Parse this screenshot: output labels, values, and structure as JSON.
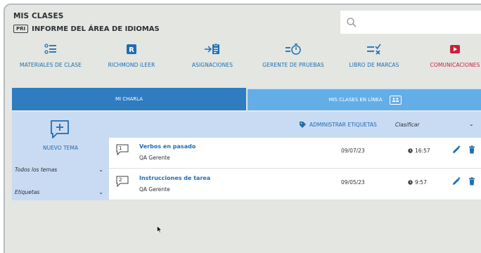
{
  "header": {
    "title": "MIS CLASES",
    "level_badge": "PRI",
    "subtitle": "INFORME DEL ÁREA DE IDIOMAS",
    "search_placeholder": ""
  },
  "nav": [
    {
      "label": "MATERIALES DE CLASE",
      "icon": "list-icon"
    },
    {
      "label": "RICHMOND iLEER",
      "icon": "richmond-r-icon"
    },
    {
      "label": "ASIGNACIONES",
      "icon": "assignment-icon"
    },
    {
      "label": "GERENTE DE PRUEBAS",
      "icon": "timer-icon"
    },
    {
      "label": "LIBRO DE MARCAS",
      "icon": "gradebook-icon"
    },
    {
      "label": "COMUNICACIONES",
      "icon": "play-icon"
    }
  ],
  "tabs": {
    "active": "MI CHARLA",
    "inactive": "MIS CLASES EN LÍNEA"
  },
  "sidebar": {
    "new_topic": "NUEVO TEMA",
    "filters": [
      "Todos los temas",
      "Etiquetas"
    ]
  },
  "toolbar": {
    "manage_tags": "ADMINISTRAR ETIQUETAS",
    "sort": "Clasificar"
  },
  "topics": [
    {
      "num": "1",
      "title": "Verbos en pasado",
      "author": "QA Gerente",
      "date": "09/07/23",
      "time": "16:57"
    },
    {
      "num": "2",
      "title": "Instrucciones de tarea",
      "author": "QA Gerente",
      "date": "09/05/23",
      "time": "9:57"
    }
  ],
  "colors": {
    "brand_blue": "#1f6db3",
    "tab_active": "#2f7cc1",
    "tab_inactive": "#64aee8",
    "panel": "#c9dbf3",
    "alert_red": "#cc1f3c"
  }
}
